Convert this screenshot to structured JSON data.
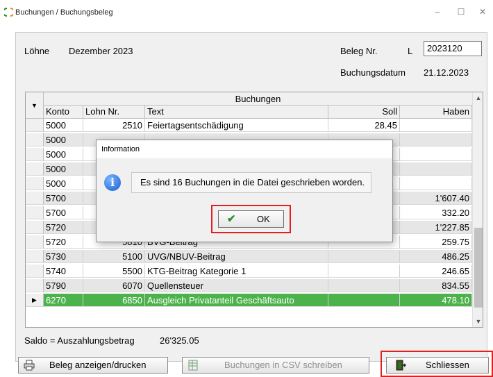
{
  "window": {
    "title": "Buchungen / Buchungsbeleg",
    "minimize": "–",
    "maximize": "☐",
    "close": "✕"
  },
  "header": {
    "category": "Löhne",
    "period": "Dezember 2023",
    "beleg_label": "Beleg Nr.",
    "beleg_prefix": "L",
    "beleg_value": "2023120",
    "date_label": "Buchungsdatum",
    "date_value": "21.12.2023"
  },
  "grid": {
    "group_header": "Buchungen",
    "columns": [
      "Konto",
      "Lohn Nr.",
      "Text",
      "Soll",
      "Haben"
    ],
    "rows": [
      {
        "konto": "5000",
        "lohn": "2510",
        "text": "Feiertagsentschädigung",
        "soll": "28.45",
        "haben": ""
      },
      {
        "konto": "5000",
        "lohn": "",
        "text": "",
        "soll": "",
        "haben": ""
      },
      {
        "konto": "5000",
        "lohn": "",
        "text": "",
        "soll": "",
        "haben": ""
      },
      {
        "konto": "5000",
        "lohn": "",
        "text": "",
        "soll": "",
        "haben": ""
      },
      {
        "konto": "5000",
        "lohn": "",
        "text": "",
        "soll": "",
        "haben": ""
      },
      {
        "konto": "5700",
        "lohn": "",
        "text": "",
        "soll": "",
        "haben": "1'607.40"
      },
      {
        "konto": "5700",
        "lohn": "",
        "text": "",
        "soll": "",
        "haben": "332.20"
      },
      {
        "konto": "5720",
        "lohn": "",
        "text": "",
        "soll": "",
        "haben": "1'227.85"
      },
      {
        "konto": "5720",
        "lohn": "5810",
        "text": "BVG-Beitrag",
        "soll": "",
        "haben": "259.75"
      },
      {
        "konto": "5730",
        "lohn": "5100",
        "text": "UVG/NBUV-Beitrag",
        "soll": "",
        "haben": "486.25"
      },
      {
        "konto": "5740",
        "lohn": "5500",
        "text": "KTG-Beitrag Kategorie 1",
        "soll": "",
        "haben": "246.65"
      },
      {
        "konto": "5790",
        "lohn": "6070",
        "text": "Quellensteuer",
        "soll": "",
        "haben": "834.55"
      },
      {
        "konto": "6270",
        "lohn": "6850",
        "text": "Ausgleich Privatanteil Geschäftsauto",
        "soll": "",
        "haben": "478.10"
      }
    ],
    "selected_row": 12
  },
  "dialog": {
    "title": "Information",
    "message": "Es sind 16 Buchungen in die Datei geschrieben worden.",
    "ok_label": "OK",
    "highlight_color": "#e02020"
  },
  "footer": {
    "saldo_label": "Saldo = Auszahlungsbetrag",
    "saldo_value": "26'325.05",
    "btn_print": "Beleg anzeigen/drucken",
    "btn_csv": "Buchungen in CSV schreiben",
    "btn_close": "Schliessen"
  },
  "colors": {
    "selection": "#4cb34c",
    "alt_row": "#e6e6e6"
  }
}
